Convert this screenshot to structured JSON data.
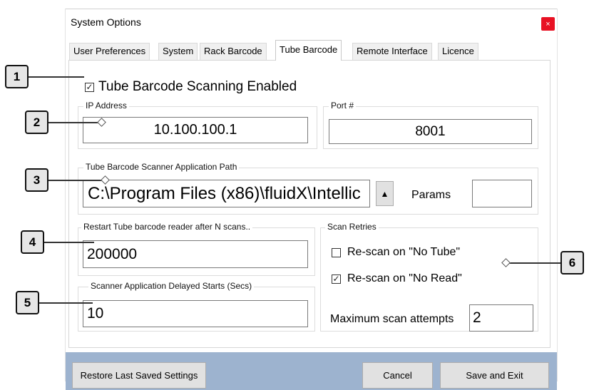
{
  "window": {
    "title": "System Options",
    "close_glyph": "×"
  },
  "tabs": [
    {
      "label": "User Preferences",
      "active": false
    },
    {
      "label": "System",
      "active": false
    },
    {
      "label": "Rack Barcode",
      "active": false
    },
    {
      "label": "Tube Barcode",
      "active": true
    },
    {
      "label": "Remote Interface",
      "active": false
    },
    {
      "label": "Licence",
      "active": false
    }
  ],
  "tube_barcode": {
    "scanning_enabled": {
      "label": "Tube Barcode Scanning Enabled",
      "checked": true,
      "glyph": "✓"
    },
    "ip_address": {
      "legend": "IP Address",
      "value": "10.100.100.1"
    },
    "port": {
      "legend": "Port #",
      "value": "8001"
    },
    "app_path": {
      "legend": "Tube Barcode Scanner Application Path",
      "value": "C:\\Program Files (x86)\\fluidX\\Intellic",
      "browse_glyph": "▲",
      "params_label": "Params",
      "params_value": ""
    },
    "restart": {
      "legend": "Restart Tube barcode reader after N scans..",
      "value": "200000"
    },
    "delayed_starts": {
      "legend": "Scanner Application Delayed Starts (Secs)",
      "value": "10"
    },
    "scan_retries": {
      "legend": "Scan Retries",
      "rescan_no_tube": {
        "label": "Re-scan on \"No Tube\"",
        "checked": false,
        "glyph": ""
      },
      "rescan_no_read": {
        "label": "Re-scan on \"No Read\"",
        "checked": true,
        "glyph": "✓"
      },
      "max_attempts_label": "Maximum scan attempts",
      "max_attempts_value": "2"
    }
  },
  "footer": {
    "restore_label": "Restore Last Saved Settings",
    "cancel_label": "Cancel",
    "save_exit_label": "Save and Exit"
  },
  "callouts": [
    "1",
    "2",
    "3",
    "4",
    "5",
    "6"
  ],
  "colors": {
    "close_button": "#e81123",
    "footer": "#9db3cf",
    "callout_fill": "#e6e6e6"
  }
}
